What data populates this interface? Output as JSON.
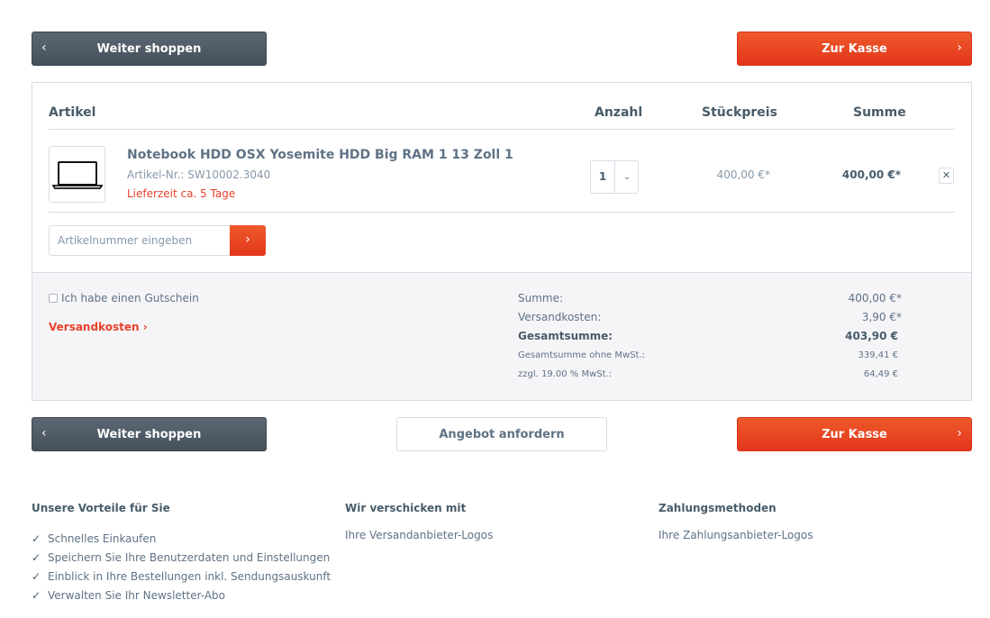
{
  "actions": {
    "continue_shopping": "Weiter shoppen",
    "checkout": "Zur Kasse",
    "request_offer": "Angebot anfordern"
  },
  "table": {
    "headers": {
      "item": "Artikel",
      "quantity": "Anzahl",
      "unit_price": "Stückpreis",
      "total": "Summe"
    }
  },
  "item": {
    "image_icon": "laptop-icon",
    "name": "Notebook HDD OSX Yosemite HDD Big RAM 1 13 Zoll 1",
    "article_number": "Artikel-Nr.: SW10002.3040",
    "delivery": "Lieferzeit ca. 5 Tage",
    "quantity": "1",
    "unit_price": "400,00 €*",
    "total": "400,00 €*",
    "remove_label": "✕"
  },
  "add_article": {
    "placeholder": "Artikelnummer eingeben",
    "button_label": "›"
  },
  "voucher_label": "Ich habe einen Gutschein",
  "shipping_link": "Versandkosten ›",
  "summary": [
    {
      "label": "Summe:",
      "value": "400,00 €*"
    },
    {
      "label": "Versandkosten:",
      "value": "3,90 €*"
    },
    {
      "label": "Gesamtsumme:",
      "value": "403,90 €"
    },
    {
      "label": "Gesamtsumme ohne MwSt.:",
      "value": "339,41 €"
    },
    {
      "label": "zzgl. 19.00 % MwSt.:",
      "value": "64,49 €"
    }
  ],
  "footer": {
    "advantages_title": "Unsere Vorteile für Sie",
    "advantages": [
      "Schnelles Einkaufen",
      "Speichern Sie Ihre Benutzerdaten und Einstellungen",
      "Einblick in Ihre Bestellungen inkl. Sendungsauskunft",
      "Verwalten Sie Ihr Newsletter-Abo"
    ],
    "shipping_title": "Wir verschicken mit",
    "shipping_text": "Ihre Versandanbieter-Logos",
    "payment_title": "Zahlungsmethoden",
    "payment_text": "Ihre Zahlungsanbieter-Logos"
  },
  "colors": {
    "accent": "#e9412a",
    "dark_button": "#4f5b67",
    "text": "#5f7285",
    "border": "#dadae5"
  }
}
